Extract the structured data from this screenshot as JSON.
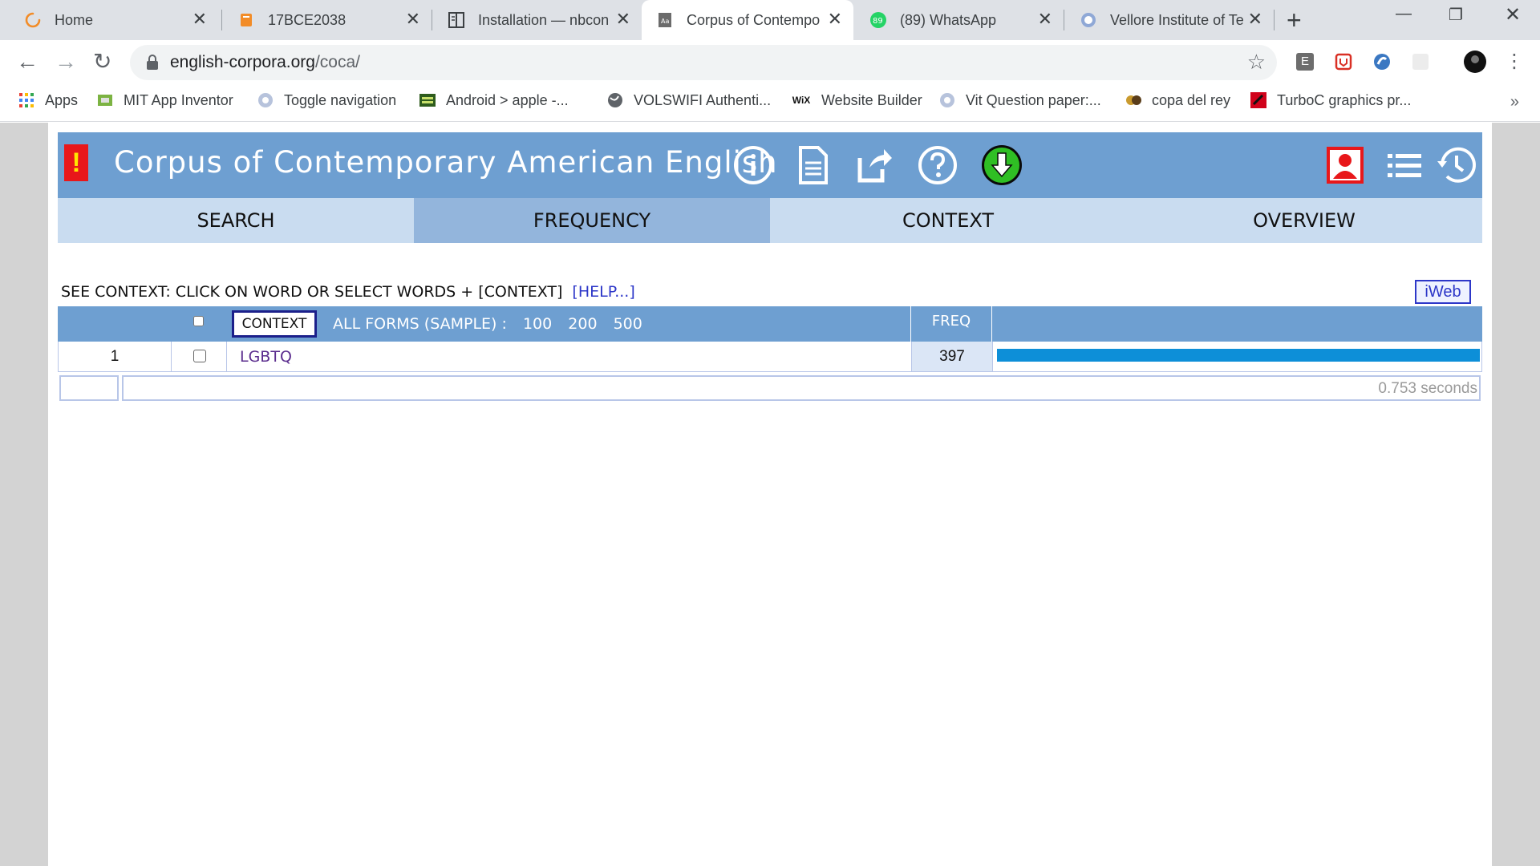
{
  "browser": {
    "tabs": [
      {
        "title": "Home",
        "icon": "loading-spinner-icon",
        "active": false
      },
      {
        "title": "17BCE2038",
        "icon": "book-icon",
        "active": false
      },
      {
        "title": "Installation — nbcon",
        "icon": "doc-reader-icon",
        "active": false
      },
      {
        "title": "Corpus of Contempo",
        "icon": "page-icon",
        "active": true
      },
      {
        "title": "(89) WhatsApp",
        "icon": "whatsapp-icon",
        "active": false,
        "badge": "89"
      },
      {
        "title": "Vellore Institute of Te",
        "icon": "vit-icon",
        "active": false
      }
    ],
    "url_domain": "english-corpora.org",
    "url_path": "/coca/",
    "extensions": [
      {
        "label": "E",
        "color": "#6d6d6d"
      },
      {
        "label": "",
        "color": "#d93025"
      },
      {
        "label": "",
        "color": "#3b78c2"
      },
      {
        "label": "",
        "color": "#e8e8e8"
      }
    ],
    "bookmarks": [
      {
        "label": "Apps",
        "icon": "apps-grid-icon"
      },
      {
        "label": "MIT App Inventor",
        "icon": "app-inventor-icon"
      },
      {
        "label": "Toggle navigation",
        "icon": "vit-icon"
      },
      {
        "label": "Android > apple -...",
        "icon": "android-icon"
      },
      {
        "label": "VOLSWIFI Authenti...",
        "icon": "globe-icon"
      },
      {
        "label": "Website Builder",
        "icon": "wix-icon",
        "icon_text": "WiX"
      },
      {
        "label": "Vit Question paper:...",
        "icon": "vit-icon"
      },
      {
        "label": "copa del rey",
        "icon": "soccer-icon"
      },
      {
        "label": "TurboC graphics pr...",
        "icon": "turboc-icon"
      }
    ]
  },
  "coca": {
    "alert_mark": "!",
    "title": "Corpus of Contemporary American English",
    "nav": [
      {
        "label": "SEARCH",
        "active": false
      },
      {
        "label": "FREQUENCY",
        "active": true
      },
      {
        "label": "CONTEXT",
        "active": false
      },
      {
        "label": "OVERVIEW",
        "active": false
      }
    ],
    "help_text": "SEE CONTEXT: CLICK ON WORD OR SELECT WORDS + [CONTEXT]",
    "help_link": "[HELP...]",
    "iweb": "iWeb",
    "table": {
      "context_button": "CONTEXT",
      "all_forms": "ALL FORMS  (SAMPLE) :",
      "sample_options": [
        "100",
        "200",
        "500"
      ],
      "freq_header": "FREQ",
      "rows": [
        {
          "rank": "1",
          "word": "LGBTQ",
          "freq": "397",
          "bar_fraction": 1.0
        }
      ],
      "timing": "0.753 seconds"
    },
    "colors": {
      "banner": "#6e9fd1",
      "nav": "#c9dcf0",
      "nav_active": "#93b5dc",
      "bar": "#0d8fd8"
    }
  }
}
